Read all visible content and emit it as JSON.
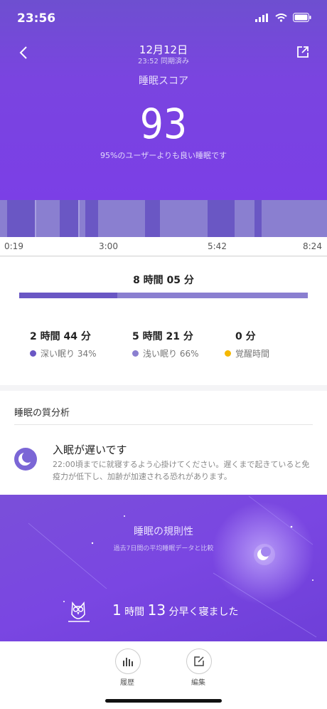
{
  "status": {
    "time": "23:56"
  },
  "header": {
    "title": "12月12日",
    "subtitle": "23:52 同期済み"
  },
  "score": {
    "label": "睡眠スコア",
    "value": "93",
    "description": "95%のユーザーよりも良い睡眠です"
  },
  "timeline": {
    "ticks": [
      "0:19",
      "3:00",
      "5:42",
      "8:24"
    ]
  },
  "summary": {
    "total": "8 時間 05 分",
    "deep_fraction": 0.34,
    "deep": {
      "value": "2 時間 44 分",
      "label": "深い眠り 34%"
    },
    "light": {
      "value": "5 時間 21 分",
      "label": "浅い眠り 66%"
    },
    "awake": {
      "value": "0 分",
      "label": "覚醒時間"
    },
    "colors": {
      "deep": "#6a57c4",
      "light": "#8a7fd0",
      "awake": "#f5b800"
    }
  },
  "analysis": {
    "title": "睡眠の質分析",
    "heading": "入眠が遅いです",
    "body": "22:00頃までに就寝するよう心掛けてください。遅くまで起きていると免疫力が低下し、加齢が加速される恐れがあります。"
  },
  "regularity": {
    "title": "睡眠の規則性",
    "subtitle": "過去7日間の平均睡眠データと比較",
    "result_num1": "1",
    "result_unit1": "時間",
    "result_num2": "13",
    "result_tail": "分早く寝ました"
  },
  "tabs": [
    {
      "label": "履歴",
      "icon": "bar-chart-icon"
    },
    {
      "label": "編集",
      "icon": "edit-icon"
    }
  ]
}
